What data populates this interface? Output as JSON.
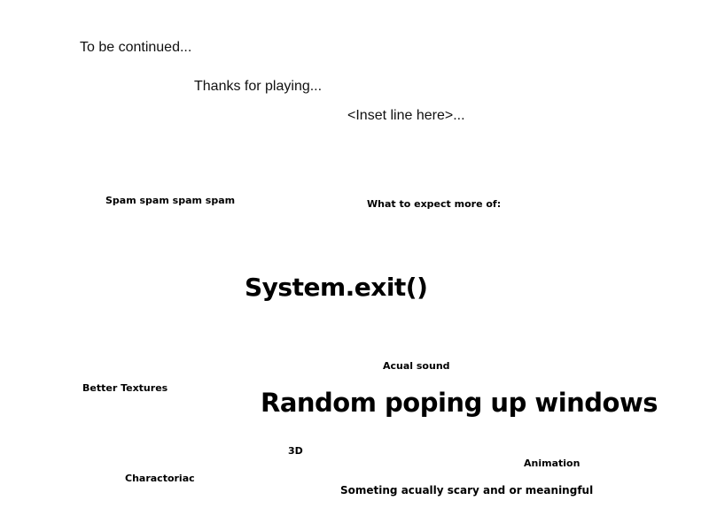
{
  "credits": {
    "line1": "To be continued...",
    "line2": "Thanks for playing...",
    "line3": "<Inset line here>...",
    "spam": "Spam spam spam spam",
    "expect_heading": "What to expect more of:",
    "exit_text": "System.exit()",
    "features": {
      "actual_sound": "Acual sound",
      "better_textures": "Better Textures",
      "popups": "Random poping up windows",
      "three_d": "3D",
      "animation": "Animation",
      "charactoriac": "Charactoriac",
      "scary": "Someting acually scary and or meaningful"
    }
  }
}
